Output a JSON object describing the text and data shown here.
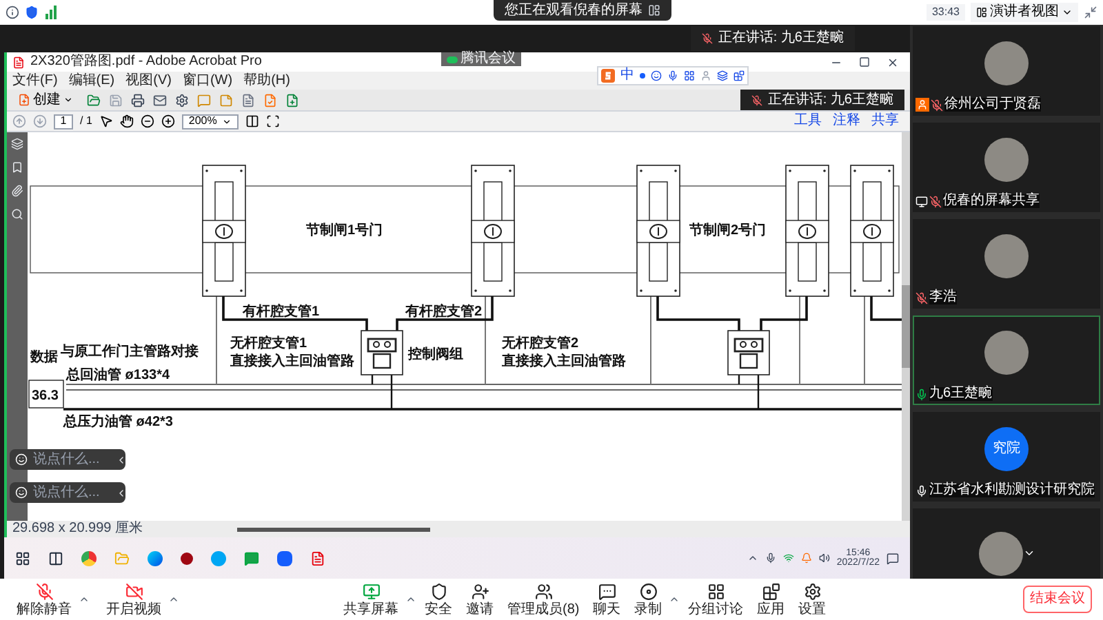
{
  "top_bar": {
    "notice": "您正在观看倪春的屏幕",
    "timer": "33:43",
    "view_button": "演讲者视图"
  },
  "speaker_banner": "正在讲话: 九6王楚畹",
  "meeting_badge": "腾讯会议",
  "acrobat": {
    "title": "2X320管路图.pdf - Adobe Acrobat Pro",
    "menu": [
      "文件(F)",
      "编辑(E)",
      "视图(V)",
      "窗口(W)",
      "帮助(H)"
    ],
    "ime_mode": "中",
    "create_button": "创建",
    "page_value": "1",
    "page_total": "/ 1",
    "zoom": "200%",
    "panel_links": [
      "工具",
      "注释",
      "共享"
    ],
    "speaker_overlay": "正在讲话: 九6王楚畹",
    "page_size": "29.698 x 20.999 厘米"
  },
  "drawing": {
    "labels": [
      "数据",
      "36.3",
      "节制闸1号门",
      "节制闸2号门",
      "有杆腔支管1",
      "有杆腔支管2",
      "与原工作门主管路对接",
      "无杆腔支管1",
      "直接接入主回油管路",
      "控制阀组",
      "无杆腔支管2",
      "直接接入主回油管路",
      "总回油管 ø133*4",
      "总压力油管 ø42*3"
    ]
  },
  "chat_inputs": [
    {
      "placeholder": "说点什么..."
    },
    {
      "placeholder": "说点什么..."
    }
  ],
  "taskbar": {
    "time": "15:46",
    "date": "2022/7/22"
  },
  "participants": [
    {
      "name": "徐州公司于贤磊",
      "kind": "photo",
      "muted": true,
      "speaking": false,
      "host": true,
      "sharing": false
    },
    {
      "name": "倪春的屏幕共享",
      "kind": "photo",
      "muted": true,
      "speaking": false,
      "host": false,
      "sharing": true
    },
    {
      "name": "李浩",
      "kind": "photo",
      "muted": true,
      "speaking": false,
      "host": false,
      "sharing": false
    },
    {
      "name": "九6王楚畹",
      "kind": "photo",
      "muted": false,
      "speaking": true,
      "host": false,
      "sharing": false
    },
    {
      "name": "江苏省水利勘测设计研究院",
      "kind": "text",
      "initials": "究院",
      "muted": false,
      "speaking": false,
      "host": false,
      "sharing": false
    },
    {
      "kind": "photo"
    }
  ],
  "toolbar": {
    "left": [
      {
        "label": "解除静音",
        "kind": "mic",
        "caret": true
      },
      {
        "label": "开启视频",
        "kind": "video",
        "caret": true
      }
    ],
    "center": [
      {
        "label": "共享屏幕",
        "kind": "share",
        "caret": true
      },
      {
        "label": "安全",
        "kind": "security",
        "caret": false
      },
      {
        "label": "邀请",
        "kind": "invite",
        "caret": false
      },
      {
        "label": "管理成员(8)",
        "kind": "members",
        "caret": false
      },
      {
        "label": "聊天",
        "kind": "chat",
        "caret": false
      },
      {
        "label": "录制",
        "kind": "record",
        "caret": true
      },
      {
        "label": "分组讨论",
        "kind": "breakout",
        "caret": false
      },
      {
        "label": "应用",
        "kind": "apps",
        "caret": false
      },
      {
        "label": "设置",
        "kind": "settings",
        "caret": false
      }
    ],
    "end_button": "结束会议"
  }
}
